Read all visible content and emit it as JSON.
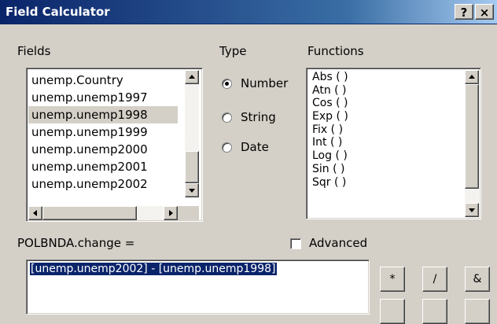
{
  "window": {
    "title": "Field Calculator",
    "help_label": "?",
    "close_label": "×"
  },
  "fields": {
    "label": "Fields",
    "items": [
      {
        "label": "unemp.Country",
        "selected": false
      },
      {
        "label": "unemp.unemp1997",
        "selected": false
      },
      {
        "label": "unemp.unemp1998",
        "selected": true
      },
      {
        "label": "unemp.unemp1999",
        "selected": false
      },
      {
        "label": "unemp.unemp2000",
        "selected": false
      },
      {
        "label": "unemp.unemp2001",
        "selected": false
      },
      {
        "label": "unemp.unemp2002",
        "selected": false
      }
    ]
  },
  "type": {
    "label": "Type",
    "options": [
      {
        "label": "Number",
        "checked": true
      },
      {
        "label": "String",
        "checked": false
      },
      {
        "label": "Date",
        "checked": false
      }
    ]
  },
  "functions": {
    "label": "Functions",
    "items": [
      "Abs ( )",
      "Atn ( )",
      "Cos ( )",
      "Exp ( )",
      "Fix ( )",
      "Int ( )",
      "Log ( )",
      "Sin ( )",
      "Sqr ( )"
    ]
  },
  "expression": {
    "target_label": "POLBNDA.change =",
    "advanced_label": "Advanced",
    "advanced_checked": false,
    "value": "[unemp.unemp2002] - [unemp.unemp1998]"
  },
  "operators": [
    "*",
    "/",
    "&"
  ]
}
